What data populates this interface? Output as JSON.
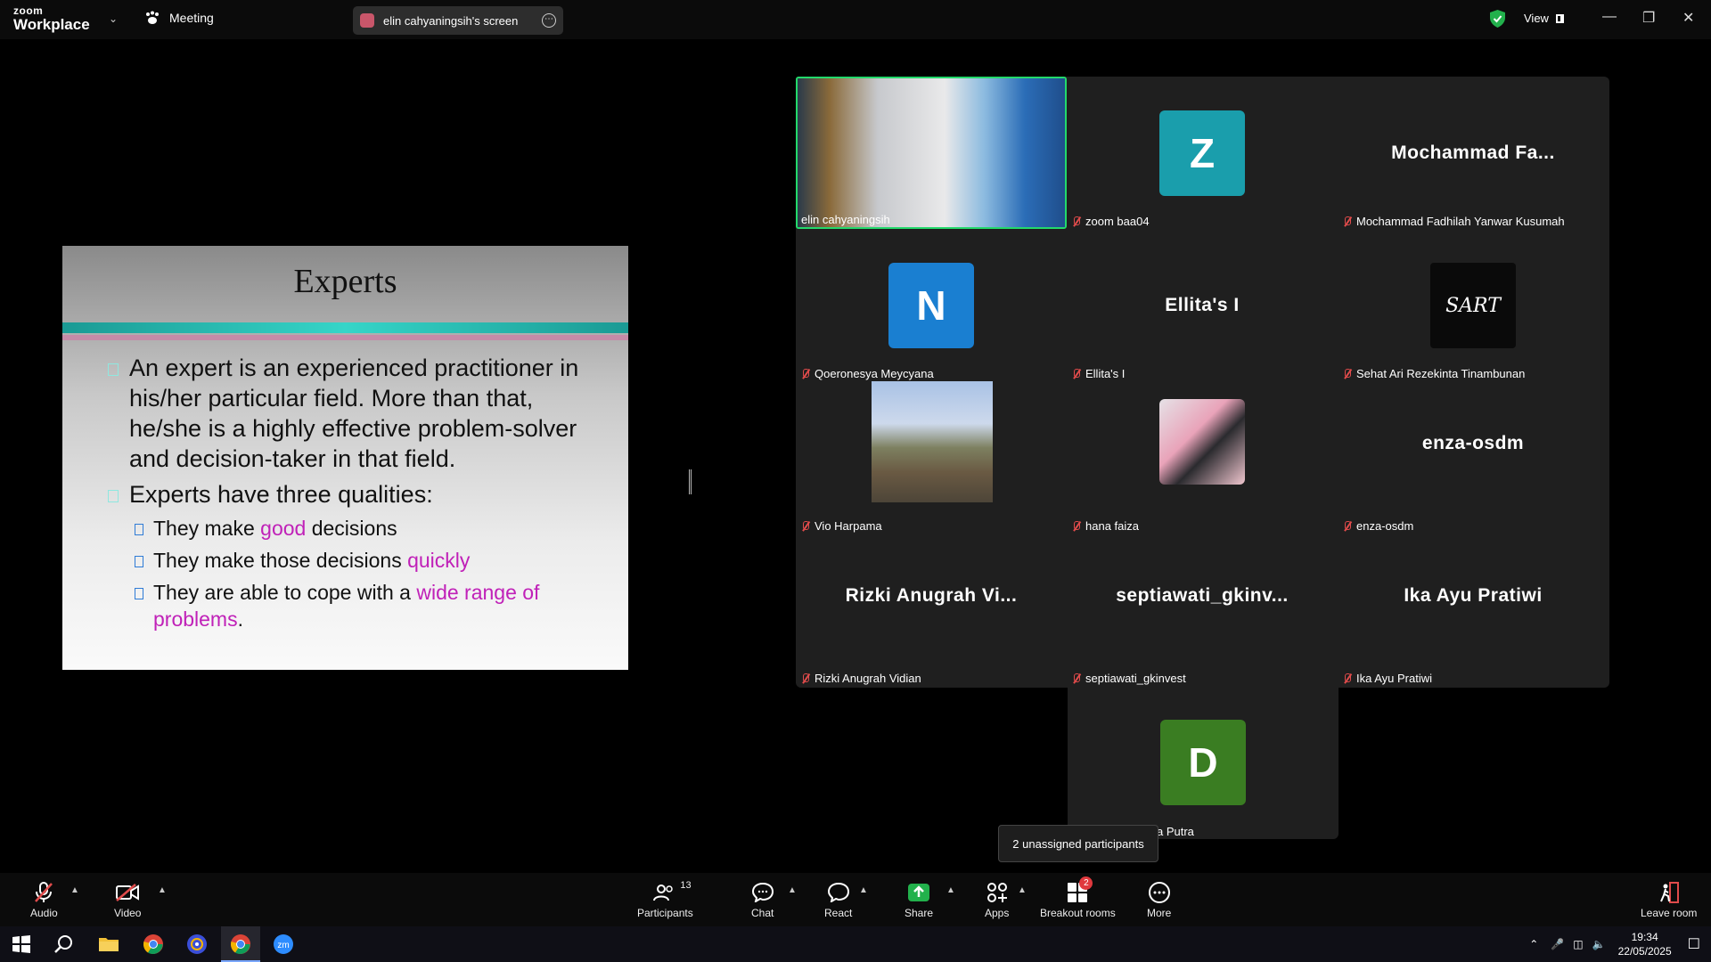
{
  "app": {
    "logo_line1": "zoom",
    "logo_line2": "Workplace",
    "meeting_label": "Meeting",
    "screen_share_label": "elin cahyaningsih's screen",
    "view_label": "View"
  },
  "slide": {
    "title": "Experts",
    "bullet1": "An expert is an experienced practitioner in his/her particular field. More than that, he/she is a highly effective problem-solver and decision-taker in that field.",
    "bullet2": "Experts have three qualities:",
    "sub1_pre": "They make ",
    "sub1_hl": "good",
    "sub1_post": " decisions",
    "sub2_pre": "They make those decisions ",
    "sub2_hl": "quickly",
    "sub3_pre": "They are able to cope with a ",
    "sub3_hl": "wide range of problems",
    "sub3_post": ".",
    "highlight_color": "#c021b8"
  },
  "participants": [
    {
      "name": "elin cahyaningsih",
      "type": "video",
      "active": true
    },
    {
      "name": "zoom baa04",
      "type": "initial",
      "initial": "Z",
      "color": "#1a9eac"
    },
    {
      "name": "Mochammad Fadhilah Yanwar Kusumah",
      "type": "name",
      "display": "Mochammad Fa..."
    },
    {
      "name": "Qoeronesya Meycyana",
      "type": "initial",
      "initial": "N",
      "color": "#1a7fd1"
    },
    {
      "name": "Ellita's I",
      "type": "name",
      "display": "Ellita's I"
    },
    {
      "name": "Sehat Ari Rezekinta Tinambunan",
      "type": "logo",
      "display": "SART"
    },
    {
      "name": "Vio Harpama",
      "type": "photo"
    },
    {
      "name": "hana faiza",
      "type": "photo"
    },
    {
      "name": "enza-osdm",
      "type": "name",
      "display": "enza-osdm"
    },
    {
      "name": "Rizki Anugrah Vidian",
      "type": "name",
      "display": "Rizki Anugrah Vi..."
    },
    {
      "name": "septiawati_gkinvest",
      "type": "name",
      "display": "septiawati_gkinv..."
    },
    {
      "name": "Ika Ayu Pratiwi",
      "type": "name",
      "display": "Ika Ayu Pratiwi"
    },
    {
      "name": "a Putra",
      "type": "initial",
      "initial": "D",
      "color": "#3a7d22"
    }
  ],
  "tooltip": "2 unassigned participants",
  "toolbar": {
    "audio": "Audio",
    "video": "Video",
    "participants": "Participants",
    "participants_count": "13",
    "chat": "Chat",
    "react": "React",
    "share": "Share",
    "apps": "Apps",
    "breakout": "Breakout rooms",
    "breakout_badge": "2",
    "more": "More",
    "leave": "Leave room"
  },
  "taskbar": {
    "time": "19:34",
    "date": "22/05/2025"
  },
  "colors": {
    "active_border": "#23d96b",
    "share_green": "#22b14c",
    "mute_red": "#e04b4b"
  }
}
